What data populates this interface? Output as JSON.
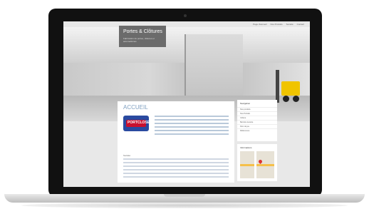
{
  "site": {
    "title": "Portes & Clôtures",
    "tagline": "Fabrication de portes, clôtures et automatismes",
    "nav": [
      "Page d'accueil",
      "Nos Produits",
      "Société",
      "Contact"
    ]
  },
  "page": {
    "heading": "ACCUEIL",
    "section_title": "Société"
  },
  "logo": {
    "text": "PORTCLOSE"
  },
  "sidebar": {
    "heading": "Navigation",
    "items": [
      "Nos produits",
      "Nos Portails",
      "Clôture",
      "Barrière levante",
      "Parc de jeu",
      "Références"
    ]
  },
  "info": {
    "heading": "Informations"
  },
  "colors": {
    "accent": "#7f9fc0",
    "brand_box": "#6b6b6b",
    "forklift": "#f0c400"
  }
}
